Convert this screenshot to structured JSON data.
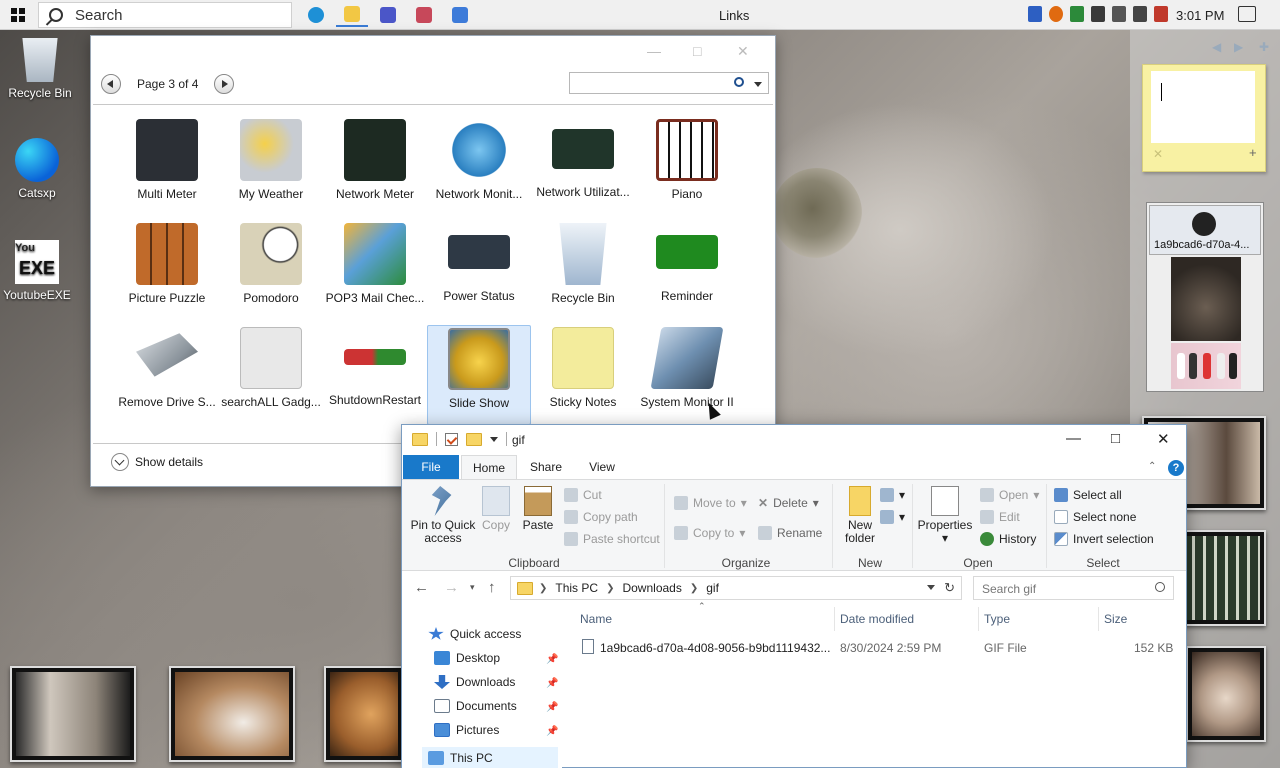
{
  "taskbar": {
    "search_placeholder": "Search",
    "links_label": "Links",
    "clock": "3:01 PM",
    "apps": [
      {
        "icon": "edge-icon",
        "color": "#1e90d6"
      },
      {
        "icon": "file-explorer-icon",
        "color": "#f2c744"
      },
      {
        "icon": "pin-app-icon",
        "color": "#4b56c8"
      },
      {
        "icon": "flag-app-icon",
        "color": "#c7485a"
      },
      {
        "icon": "gadgets-app-icon",
        "color": "#3d7bd9"
      }
    ],
    "tray_icons": [
      "bluetooth-icon",
      "search-tray-icon",
      "security-icon",
      "shield-icon",
      "usb-icon",
      "network-icon",
      "volume-muted-icon"
    ]
  },
  "desktop": {
    "icons": [
      {
        "label": "Recycle Bin",
        "icon": "recycle-bin-icon"
      },
      {
        "label": "Catsxp",
        "icon": "catsxp-icon"
      },
      {
        "label": "YoutubeEXE",
        "icon": "youtube-exe-icon"
      }
    ]
  },
  "gadget_gallery": {
    "page_label": "Page 3 of 4",
    "search_placeholder": "",
    "show_details": "Show details",
    "gadgets": [
      {
        "label": "Multi Meter",
        "color": "#2b2f35"
      },
      {
        "label": "My Weather",
        "color": "#c8ccd2"
      },
      {
        "label": "Network Meter",
        "color": "#1d2a22"
      },
      {
        "label": "Network Monit...",
        "color": "#39a0e0"
      },
      {
        "label": "Network Utilizat...",
        "color": "#20352a"
      },
      {
        "label": "Piano",
        "color": "#7a2d1f"
      },
      {
        "label": "Picture Puzzle",
        "color": "#8a4a1c"
      },
      {
        "label": "Pomodoro",
        "color": "#d9d2b8"
      },
      {
        "label": "POP3 Mail Chec...",
        "color": "#5aa0d8"
      },
      {
        "label": "Power Status",
        "color": "#2e3945"
      },
      {
        "label": "Recycle Bin",
        "color": "#b9cbe0"
      },
      {
        "label": "Reminder",
        "color": "#1f8a1f"
      },
      {
        "label": "Remove Drive S...",
        "color": "#9aa3ab"
      },
      {
        "label": "searchALL Gadg...",
        "color": "#e8e8e8"
      },
      {
        "label": "ShutdownRestart",
        "color": "#5b6b5b"
      },
      {
        "label": "Slide Show",
        "color": "#d8b22a"
      },
      {
        "label": "Sticky Notes",
        "color": "#f3ec9c"
      },
      {
        "label": "System Monitor II",
        "color": "#6e8fb0"
      }
    ],
    "selected": "Slide Show"
  },
  "sidebar_gadgets": {
    "slideshow_caption": "1a9bcad6-d70a-4..."
  },
  "explorer": {
    "folder_name": "gif",
    "tabs": [
      "File",
      "Home",
      "Share",
      "View"
    ],
    "ribbon": {
      "clipboard": {
        "label": "Clipboard",
        "pin_to_quick_access": "Pin to Quick access",
        "copy": "Copy",
        "paste": "Paste",
        "cut": "Cut",
        "copy_path": "Copy path",
        "paste_shortcut": "Paste shortcut"
      },
      "organize": {
        "label": "Organize",
        "move_to": "Move to",
        "copy_to": "Copy to",
        "delete": "Delete",
        "rename": "Rename"
      },
      "new": {
        "label": "New",
        "new_folder": "New folder"
      },
      "open": {
        "label": "Open",
        "properties": "Properties",
        "open": "Open",
        "edit": "Edit",
        "history": "History"
      },
      "select": {
        "label": "Select",
        "select_all": "Select all",
        "select_none": "Select none",
        "invert_selection": "Invert selection"
      }
    },
    "address": [
      "This PC",
      "Downloads",
      "gif"
    ],
    "search_placeholder": "Search gif",
    "nav": [
      {
        "label": "Quick access",
        "icon": "star-icon"
      },
      {
        "label": "Desktop",
        "icon": "desktop-folder-icon",
        "pinned": true
      },
      {
        "label": "Downloads",
        "icon": "downloads-folder-icon",
        "pinned": true
      },
      {
        "label": "Documents",
        "icon": "documents-folder-icon",
        "pinned": true
      },
      {
        "label": "Pictures",
        "icon": "pictures-folder-icon",
        "pinned": true
      },
      {
        "label": "This PC",
        "icon": "this-pc-icon"
      }
    ],
    "columns": [
      "Name",
      "Date modified",
      "Type",
      "Size"
    ],
    "files": [
      {
        "name": "1a9bcad6-d70a-4d08-9056-b9bd1119432...",
        "date": "8/30/2024 2:59 PM",
        "type": "GIF File",
        "size": "152 KB"
      }
    ]
  }
}
